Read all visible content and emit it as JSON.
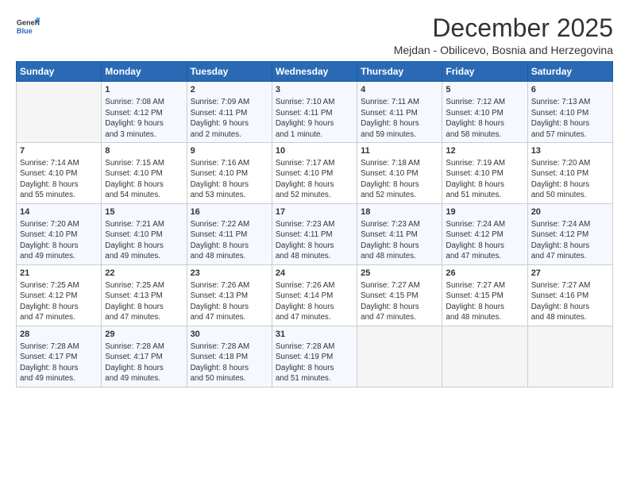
{
  "header": {
    "title": "December 2025",
    "subtitle": "Mejdan - Obilicevo, Bosnia and Herzegovina"
  },
  "columns": [
    "Sunday",
    "Monday",
    "Tuesday",
    "Wednesday",
    "Thursday",
    "Friday",
    "Saturday"
  ],
  "weeks": [
    [
      {
        "day": "",
        "info": ""
      },
      {
        "day": "1",
        "info": "Sunrise: 7:08 AM\nSunset: 4:12 PM\nDaylight: 9 hours\nand 3 minutes."
      },
      {
        "day": "2",
        "info": "Sunrise: 7:09 AM\nSunset: 4:11 PM\nDaylight: 9 hours\nand 2 minutes."
      },
      {
        "day": "3",
        "info": "Sunrise: 7:10 AM\nSunset: 4:11 PM\nDaylight: 9 hours\nand 1 minute."
      },
      {
        "day": "4",
        "info": "Sunrise: 7:11 AM\nSunset: 4:11 PM\nDaylight: 8 hours\nand 59 minutes."
      },
      {
        "day": "5",
        "info": "Sunrise: 7:12 AM\nSunset: 4:10 PM\nDaylight: 8 hours\nand 58 minutes."
      },
      {
        "day": "6",
        "info": "Sunrise: 7:13 AM\nSunset: 4:10 PM\nDaylight: 8 hours\nand 57 minutes."
      }
    ],
    [
      {
        "day": "7",
        "info": "Sunrise: 7:14 AM\nSunset: 4:10 PM\nDaylight: 8 hours\nand 55 minutes."
      },
      {
        "day": "8",
        "info": "Sunrise: 7:15 AM\nSunset: 4:10 PM\nDaylight: 8 hours\nand 54 minutes."
      },
      {
        "day": "9",
        "info": "Sunrise: 7:16 AM\nSunset: 4:10 PM\nDaylight: 8 hours\nand 53 minutes."
      },
      {
        "day": "10",
        "info": "Sunrise: 7:17 AM\nSunset: 4:10 PM\nDaylight: 8 hours\nand 52 minutes."
      },
      {
        "day": "11",
        "info": "Sunrise: 7:18 AM\nSunset: 4:10 PM\nDaylight: 8 hours\nand 52 minutes."
      },
      {
        "day": "12",
        "info": "Sunrise: 7:19 AM\nSunset: 4:10 PM\nDaylight: 8 hours\nand 51 minutes."
      },
      {
        "day": "13",
        "info": "Sunrise: 7:20 AM\nSunset: 4:10 PM\nDaylight: 8 hours\nand 50 minutes."
      }
    ],
    [
      {
        "day": "14",
        "info": "Sunrise: 7:20 AM\nSunset: 4:10 PM\nDaylight: 8 hours\nand 49 minutes."
      },
      {
        "day": "15",
        "info": "Sunrise: 7:21 AM\nSunset: 4:10 PM\nDaylight: 8 hours\nand 49 minutes."
      },
      {
        "day": "16",
        "info": "Sunrise: 7:22 AM\nSunset: 4:11 PM\nDaylight: 8 hours\nand 48 minutes."
      },
      {
        "day": "17",
        "info": "Sunrise: 7:23 AM\nSunset: 4:11 PM\nDaylight: 8 hours\nand 48 minutes."
      },
      {
        "day": "18",
        "info": "Sunrise: 7:23 AM\nSunset: 4:11 PM\nDaylight: 8 hours\nand 48 minutes."
      },
      {
        "day": "19",
        "info": "Sunrise: 7:24 AM\nSunset: 4:12 PM\nDaylight: 8 hours\nand 47 minutes."
      },
      {
        "day": "20",
        "info": "Sunrise: 7:24 AM\nSunset: 4:12 PM\nDaylight: 8 hours\nand 47 minutes."
      }
    ],
    [
      {
        "day": "21",
        "info": "Sunrise: 7:25 AM\nSunset: 4:12 PM\nDaylight: 8 hours\nand 47 minutes."
      },
      {
        "day": "22",
        "info": "Sunrise: 7:25 AM\nSunset: 4:13 PM\nDaylight: 8 hours\nand 47 minutes."
      },
      {
        "day": "23",
        "info": "Sunrise: 7:26 AM\nSunset: 4:13 PM\nDaylight: 8 hours\nand 47 minutes."
      },
      {
        "day": "24",
        "info": "Sunrise: 7:26 AM\nSunset: 4:14 PM\nDaylight: 8 hours\nand 47 minutes."
      },
      {
        "day": "25",
        "info": "Sunrise: 7:27 AM\nSunset: 4:15 PM\nDaylight: 8 hours\nand 47 minutes."
      },
      {
        "day": "26",
        "info": "Sunrise: 7:27 AM\nSunset: 4:15 PM\nDaylight: 8 hours\nand 48 minutes."
      },
      {
        "day": "27",
        "info": "Sunrise: 7:27 AM\nSunset: 4:16 PM\nDaylight: 8 hours\nand 48 minutes."
      }
    ],
    [
      {
        "day": "28",
        "info": "Sunrise: 7:28 AM\nSunset: 4:17 PM\nDaylight: 8 hours\nand 49 minutes."
      },
      {
        "day": "29",
        "info": "Sunrise: 7:28 AM\nSunset: 4:17 PM\nDaylight: 8 hours\nand 49 minutes."
      },
      {
        "day": "30",
        "info": "Sunrise: 7:28 AM\nSunset: 4:18 PM\nDaylight: 8 hours\nand 50 minutes."
      },
      {
        "day": "31",
        "info": "Sunrise: 7:28 AM\nSunset: 4:19 PM\nDaylight: 8 hours\nand 51 minutes."
      },
      {
        "day": "",
        "info": ""
      },
      {
        "day": "",
        "info": ""
      },
      {
        "day": "",
        "info": ""
      }
    ]
  ]
}
